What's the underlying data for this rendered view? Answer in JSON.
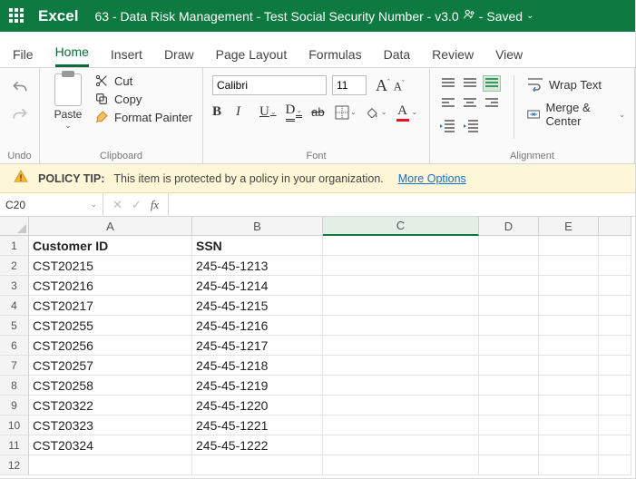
{
  "app_name": "Excel",
  "doc_title": "63 - Data Risk Management - Test Social Security Number - v3.0",
  "save_state": "Saved",
  "tabs": [
    "File",
    "Home",
    "Insert",
    "Draw",
    "Page Layout",
    "Formulas",
    "Data",
    "Review",
    "View"
  ],
  "active_tab": 1,
  "ribbon": {
    "undo_label": "Undo",
    "clipboard": {
      "paste": "Paste",
      "cut": "Cut",
      "copy": "Copy",
      "format_painter": "Format Painter",
      "group": "Clipboard"
    },
    "font": {
      "name": "Calibri",
      "size": "11",
      "group": "Font"
    },
    "alignment": {
      "wrap": "Wrap Text",
      "merge": "Merge & Center",
      "group": "Alignment"
    }
  },
  "policy": {
    "label": "POLICY TIP:",
    "text": "This item is protected by a policy in your organization.",
    "link": "More Options"
  },
  "namebox": "C20",
  "columns": [
    "A",
    "B",
    "C",
    "D",
    "E",
    ""
  ],
  "col_widths_class": [
    "wA",
    "wB",
    "wC",
    "wD",
    "wE",
    "wF"
  ],
  "selected_col_index": 2,
  "headers": [
    "Customer ID",
    "SSN"
  ],
  "rows": [
    {
      "n": 1,
      "A": "Customer ID",
      "B": "SSN",
      "bold": true
    },
    {
      "n": 2,
      "A": "CST20215",
      "B": "245-45-1213"
    },
    {
      "n": 3,
      "A": "CST20216",
      "B": "245-45-1214"
    },
    {
      "n": 4,
      "A": "CST20217",
      "B": "245-45-1215"
    },
    {
      "n": 5,
      "A": "CST20255",
      "B": "245-45-1216"
    },
    {
      "n": 6,
      "A": "CST20256",
      "B": "245-45-1217"
    },
    {
      "n": 7,
      "A": "CST20257",
      "B": "245-45-1218"
    },
    {
      "n": 8,
      "A": "CST20258",
      "B": "245-45-1219"
    },
    {
      "n": 9,
      "A": "CST20322",
      "B": "245-45-1220"
    },
    {
      "n": 10,
      "A": "CST20323",
      "B": "245-45-1221"
    },
    {
      "n": 11,
      "A": "CST20324",
      "B": "245-45-1222"
    },
    {
      "n": 12,
      "A": "",
      "B": ""
    }
  ]
}
